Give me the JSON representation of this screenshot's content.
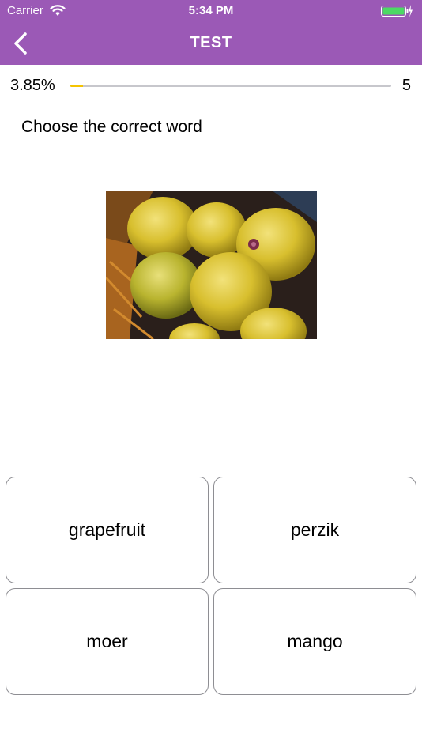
{
  "status_bar": {
    "carrier": "Carrier",
    "time": "5:34 PM",
    "wifi_icon": "wifi-icon",
    "battery_icon": "battery-charging-icon",
    "battery_color": "#4cd964"
  },
  "header": {
    "title": "TEST",
    "back_icon": "chevron-left-icon",
    "background_color": "#9b59b6"
  },
  "progress": {
    "percent_label": "3.85%",
    "fraction": 0.0385,
    "count": "5",
    "fill_color": "#f5c400"
  },
  "question": {
    "prompt": "Choose the correct word",
    "image": "photo of yellow round fruits in a basket"
  },
  "answers": [
    {
      "label": "grapefruit"
    },
    {
      "label": "perzik"
    },
    {
      "label": "moer"
    },
    {
      "label": "mango"
    }
  ]
}
